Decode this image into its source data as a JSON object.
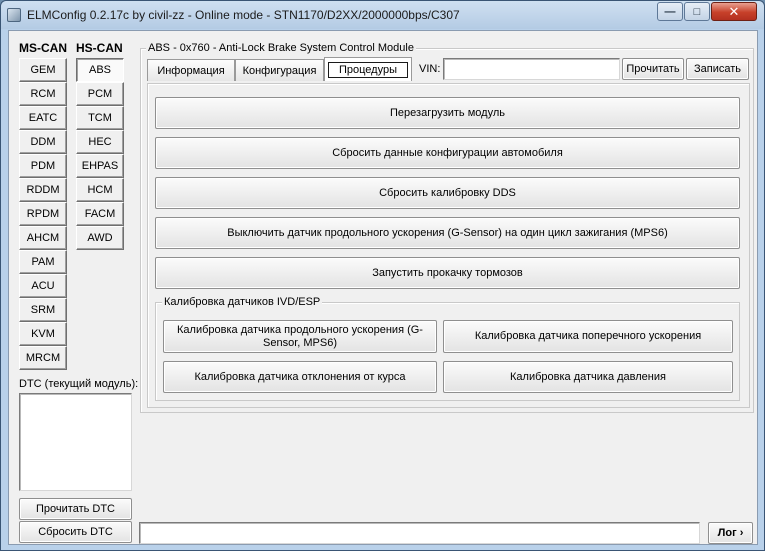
{
  "window": {
    "title": "ELMConfig 0.2.17c by civil-zz - Online mode - STN1170/D2XX/2000000bps/C307",
    "minimize": "—",
    "maximize": "□",
    "close": "✕"
  },
  "ms_can": {
    "header": "MS-CAN",
    "modules": [
      "GEM",
      "RCM",
      "EATC",
      "DDM",
      "PDM",
      "RDDM",
      "RPDM",
      "AHCM",
      "PAM",
      "ACU",
      "SRM",
      "KVM",
      "MRCM"
    ]
  },
  "hs_can": {
    "header": "HS-CAN",
    "modules": [
      "ABS",
      "PCM",
      "TCM",
      "HEC",
      "EHPAS",
      "HCM",
      "FACM",
      "AWD"
    ],
    "selected": "ABS"
  },
  "dtc": {
    "label": "DTC (текущий модуль):",
    "read_button": "Прочитать DTC",
    "clear_button": "Сбросить DTC"
  },
  "module": {
    "title": "ABS - 0x760 - Anti-Lock Brake System Control Module",
    "tabs": [
      "Информация",
      "Конфигурация",
      "Процедуры"
    ],
    "active_tab": "Процедуры",
    "vin_label": "VIN:",
    "vin_value": "",
    "read_button": "Прочитать",
    "write_button": "Записать"
  },
  "procedures": {
    "buttons": [
      "Перезагрузить модуль",
      "Сбросить данные конфигурации автомобиля",
      "Сбросить калибровку DDS",
      "Выключить датчик продольного ускорения (G-Sensor) на один цикл зажигания (MPS6)",
      "Запустить прокачку тормозов"
    ],
    "calibration_group": {
      "title": "Калибровка датчиков IVD/ESP",
      "buttons": [
        "Калибровка датчика продольного ускорения (G-Sensor, MPS6)",
        "Калибровка датчика поперечного ускорения",
        "Калибровка датчика отклонения от курса",
        "Калибровка датчика давления"
      ]
    }
  },
  "status": {
    "value": "",
    "log_button": "Лог ›"
  }
}
